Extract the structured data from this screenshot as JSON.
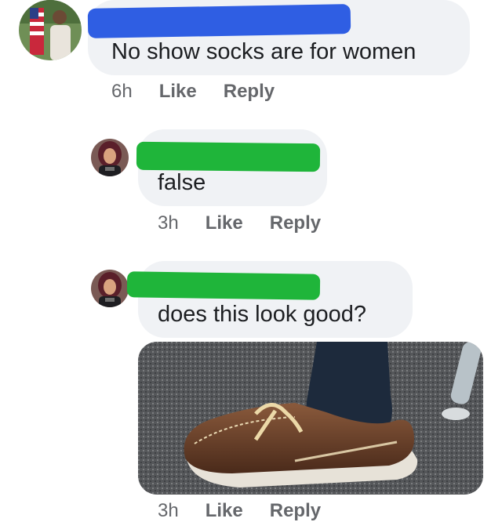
{
  "comments": [
    {
      "author_redacted": true,
      "redaction_color": "#2f5ee3",
      "text": "No show socks are for women",
      "time": "6h",
      "like_label": "Like",
      "reply_label": "Reply"
    },
    {
      "author_redacted": true,
      "redaction_color": "#1fb53a",
      "text": "false",
      "time": "3h",
      "like_label": "Like",
      "reply_label": "Reply"
    },
    {
      "author_redacted": true,
      "redaction_color": "#1fb53a",
      "text": "does this look good?",
      "time": "3h",
      "like_label": "Like",
      "reply_label": "Reply",
      "attachment": "photo of a brown boat shoe worn with a dark navy dress sock"
    }
  ],
  "colors": {
    "bubble": "#f0f2f5",
    "meta_text": "#65676b",
    "body_text": "#1c1e21"
  }
}
